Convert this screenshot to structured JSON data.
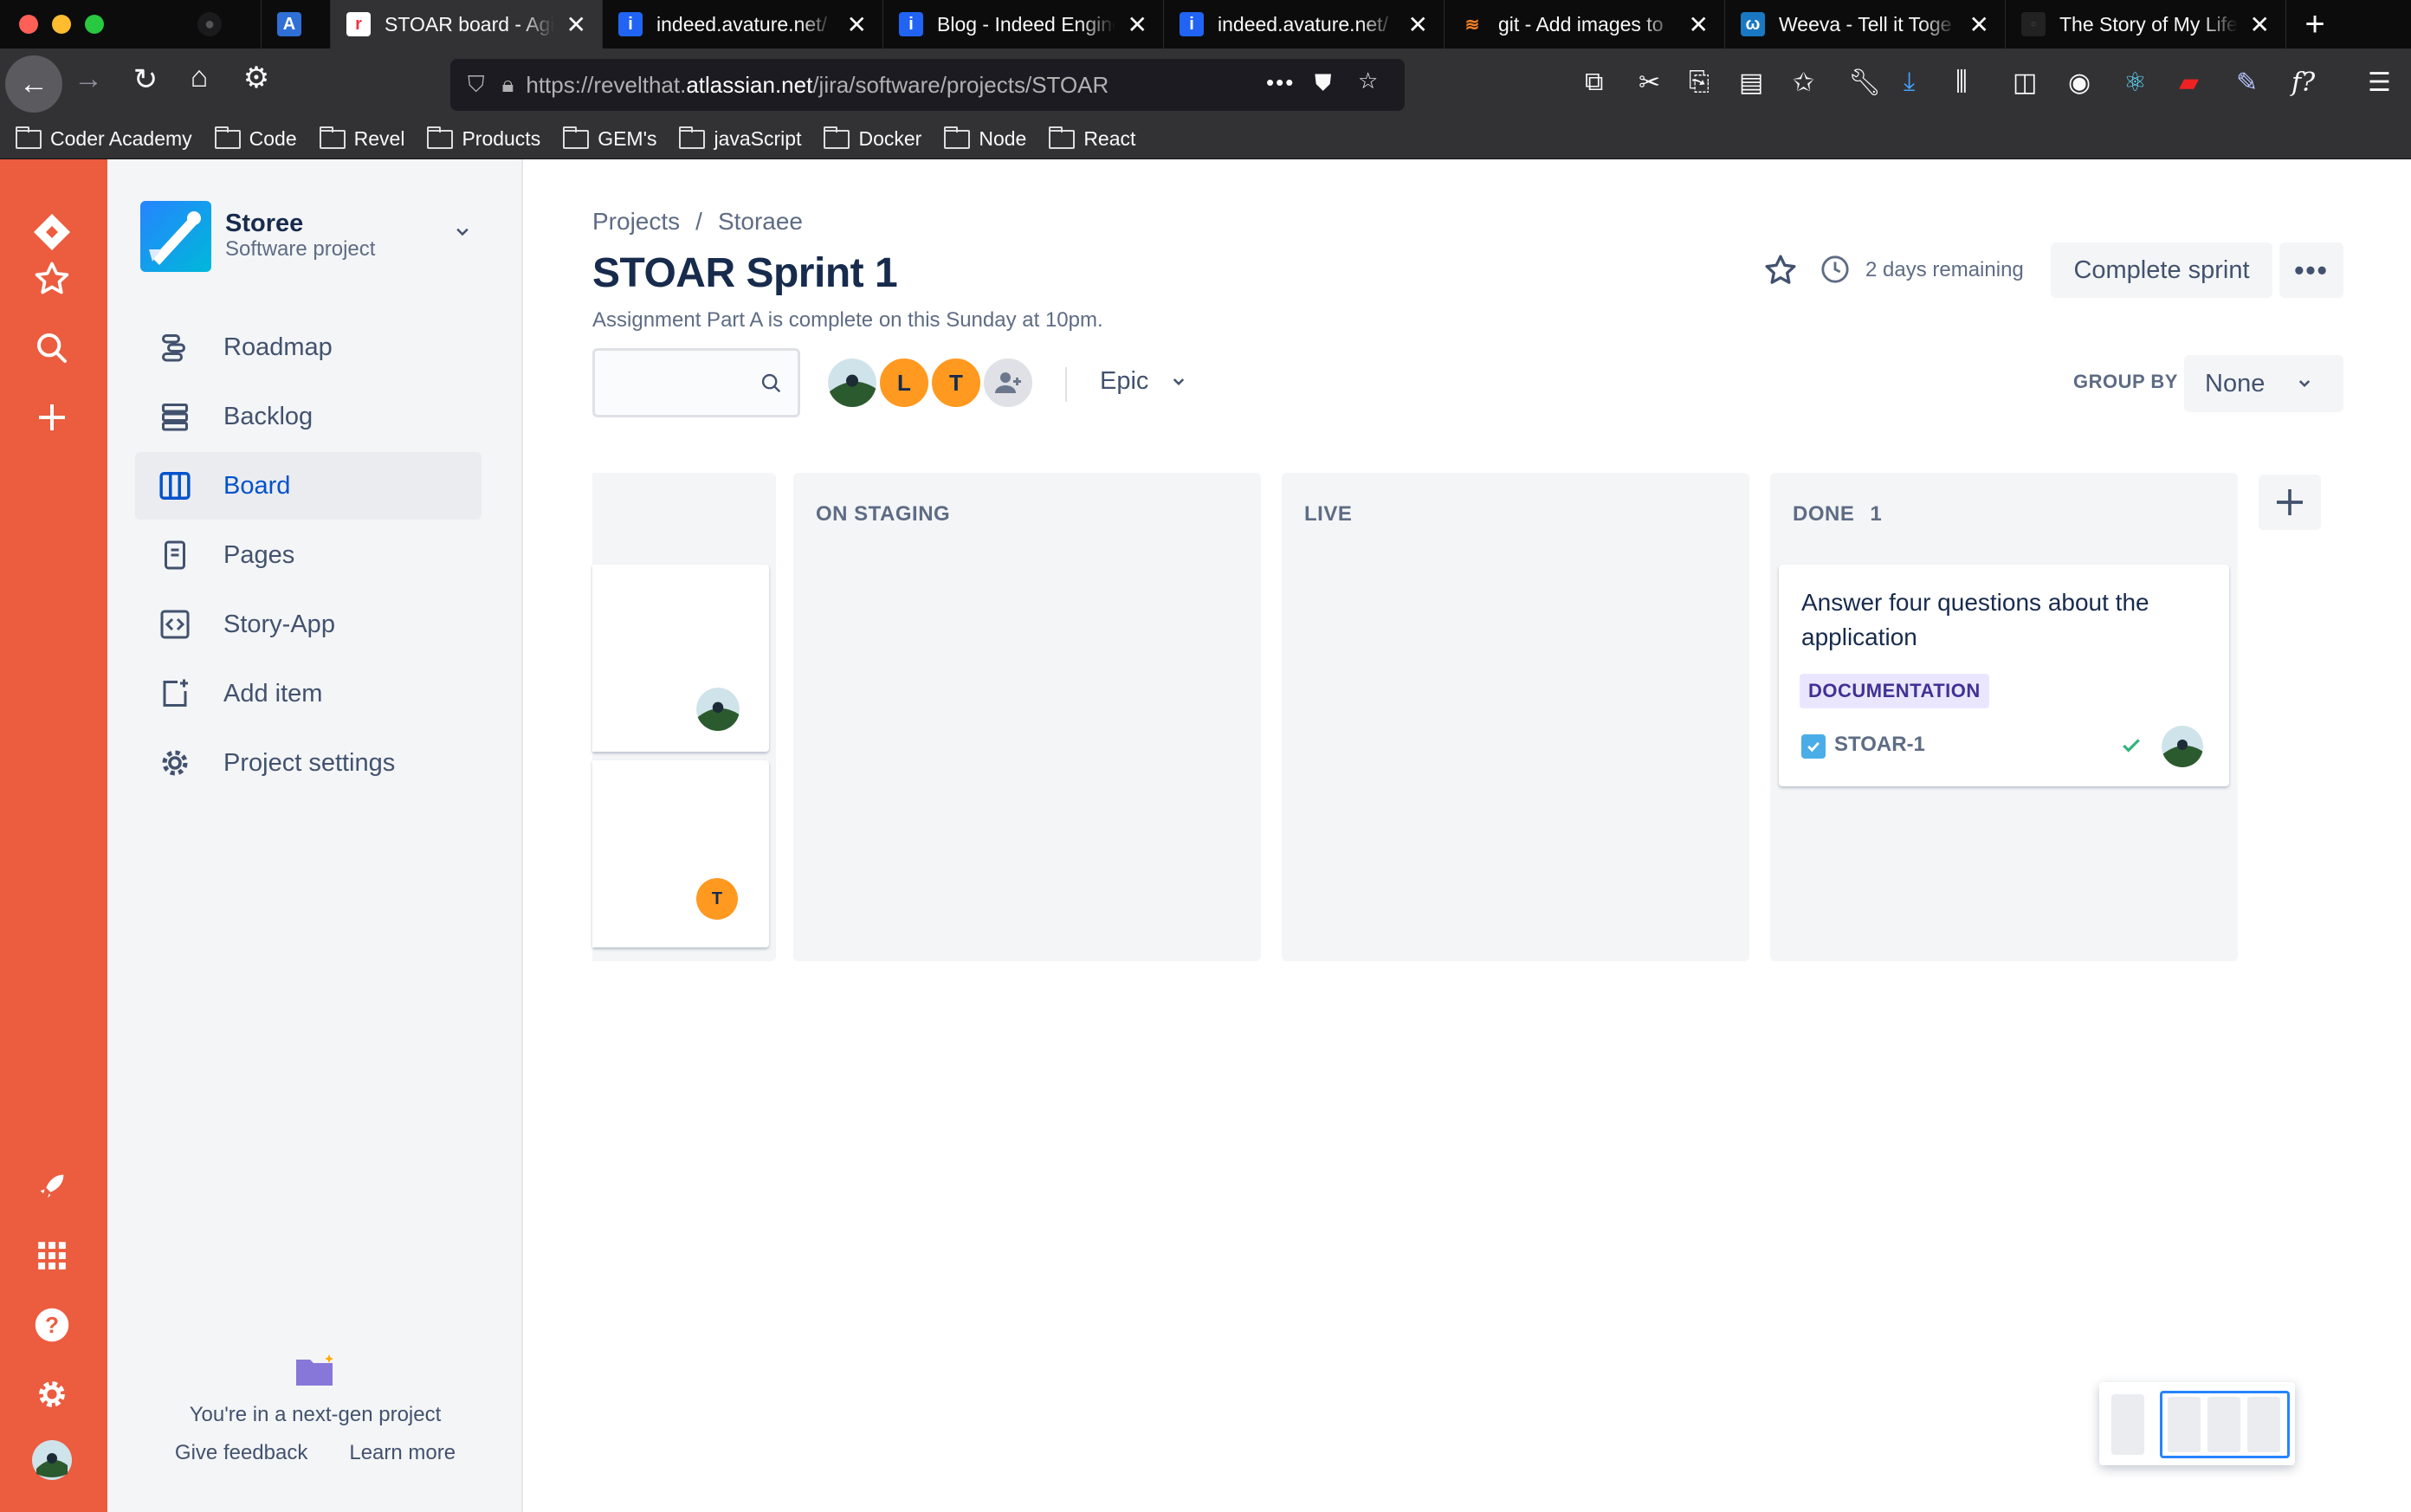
{
  "browser": {
    "tabs": [
      {
        "title": "",
        "icon": "github-icon"
      },
      {
        "title": "",
        "icon": "avature-icon"
      },
      {
        "title": "STOAR board - Agile",
        "icon": "jira-icon",
        "active": true
      },
      {
        "title": "indeed.avature.net/",
        "icon": "indeed-icon"
      },
      {
        "title": "Blog - Indeed Engine",
        "icon": "indeed-icon"
      },
      {
        "title": "indeed.avature.net/",
        "icon": "indeed-icon"
      },
      {
        "title": "git - Add images to",
        "icon": "stackoverflow-icon"
      },
      {
        "title": "Weeva - Tell it Toge",
        "icon": "weeva-icon"
      },
      {
        "title": "The Story of My Life",
        "icon": "story-icon"
      }
    ],
    "url_prefix": "https://revelthat.",
    "url_host": "atlassian.net",
    "url_rest": "/jira/software/projects/STOAR",
    "bookmarks": [
      "Coder Academy",
      "Code",
      "Revel",
      "Products",
      "GEM's",
      "javaScript",
      "Docker",
      "Node",
      "React"
    ]
  },
  "project": {
    "name": "Storee",
    "type": "Software project"
  },
  "nav": {
    "roadmap": "Roadmap",
    "backlog": "Backlog",
    "board": "Board",
    "pages": "Pages",
    "story_app": "Story-App",
    "add_item": "Add item",
    "project_settings": "Project settings"
  },
  "footer": {
    "note": "You're in a next-gen project",
    "give_feedback": "Give feedback",
    "learn_more": "Learn more"
  },
  "header": {
    "crumb_projects": "Projects",
    "crumb_separator": "/",
    "crumb_project": "Storaee",
    "sprint_title": "STOAR Sprint 1",
    "sprint_goal": "Assignment Part A is complete on this Sunday at 10pm.",
    "remaining": "2 days remaining",
    "complete_sprint": "Complete sprint",
    "more": "•••"
  },
  "filters": {
    "search_placeholder": "",
    "avatars": [
      "L",
      "T"
    ],
    "epic": "Epic",
    "group_by_label": "GROUP BY",
    "group_by_value": "None"
  },
  "columns": [
    {
      "title": "ON STAGING",
      "count": ""
    },
    {
      "title": "LIVE",
      "count": ""
    },
    {
      "title": "DONE",
      "count": "1"
    }
  ],
  "partial_column": {
    "card_2_avatar": "T"
  },
  "done_card": {
    "title": "Answer four questions about the application",
    "label": "DOCUMENTATION",
    "key": "STOAR-1"
  },
  "colors": {
    "rail": "#ec5c3f",
    "primary": "#0052cc",
    "avatar_orange": "#ff991f",
    "lozenge_bg": "#eae6ff",
    "lozenge_text": "#403294"
  }
}
